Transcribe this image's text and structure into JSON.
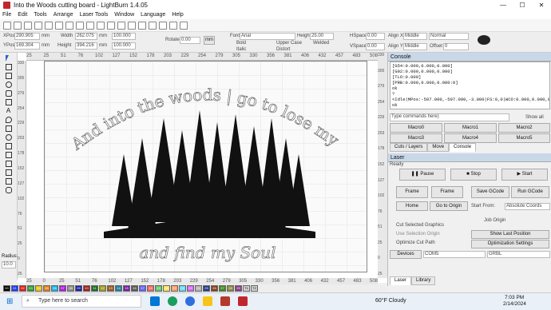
{
  "window": {
    "title": "Into the Woods cutting board - LightBurn 1.4.05"
  },
  "menu": [
    "File",
    "Edit",
    "Tools",
    "Arrange",
    "Laser Tools",
    "Window",
    "Language",
    "Help"
  ],
  "props": {
    "xpos_label": "XPos",
    "xpos": "290.905",
    "ypos_label": "YPos",
    "ypos": "169.304",
    "unit": "mm",
    "width_label": "Width",
    "width": "262.075",
    "height_label": "Height",
    "height": "394.216",
    "pct_w": "100.000",
    "pct_h": "100.000",
    "rotate_label": "Rotate",
    "rotate": "0.00",
    "font_label": "Font",
    "font": "Arial",
    "fheight_label": "Height",
    "fheight": "25.00",
    "bold": "Bold",
    "italic": "Italic",
    "upper": "Upper Case",
    "welded": "Welded",
    "distort": "Distort",
    "hspace_label": "HSpace",
    "hspace": "0.00",
    "vspace_label": "VSpace",
    "vspace": "0.00",
    "alignx_label": "Align X",
    "alignx": "Middle",
    "aligny_label": "Align Y",
    "aligny": "Middle",
    "normal": "Normal",
    "offset_label": "Offset",
    "offset": "0"
  },
  "ruler_top": [
    "25",
    "25",
    "51",
    "76",
    "102",
    "127",
    "152",
    "178",
    "203",
    "229",
    "254",
    "279",
    "305",
    "330",
    "356",
    "381",
    "406",
    "432",
    "457",
    "483",
    "508"
  ],
  "ruler_left": [
    "330",
    "305",
    "279",
    "254",
    "229",
    "203",
    "178",
    "152",
    "127",
    "102",
    "76",
    "51",
    "25",
    "0",
    "25"
  ],
  "ruler_bottom": [
    "25",
    "0",
    "25",
    "51",
    "76",
    "102",
    "127",
    "152",
    "178",
    "203",
    "229",
    "254",
    "279",
    "305",
    "330",
    "356",
    "381",
    "406",
    "432",
    "457",
    "483",
    "508"
  ],
  "design": {
    "arc_text": "And into the woods | go to lose my mind",
    "bottom_text": "and find my Soul"
  },
  "console": {
    "title": "Console",
    "lines": [
      "[G54:0.000,0.000,0.000]",
      "[G92:0.000,0.000,0.000]",
      "[TLO:0.000]",
      "[PRB:0.000,0.000,0.000:0]",
      "ok",
      "?",
      "<Idle|MPos:-597.000,-597.000,-3.000|FS:0,0|WCO:0.000,0.000,0.000>",
      "ok"
    ],
    "placeholder": "Type commands here)",
    "show_all": "Show all",
    "macros": [
      "Macro0",
      "Macro1",
      "Macro2",
      "Macro3",
      "Macro4",
      "Macro5"
    ],
    "tabs": [
      "Cuts / Layers",
      "Move",
      "Console"
    ]
  },
  "laser": {
    "title": "Laser",
    "status": "Ready",
    "pause": "Pause",
    "stop": "Stop",
    "start": "Start",
    "frame1": "Frame",
    "frame2": "Frame",
    "save_gcode": "Save GCode",
    "run_gcode": "Run GCode",
    "home": "Home",
    "goto_origin": "Go to Origin",
    "start_from_label": "Start From:",
    "start_from": "Absolute Coords",
    "job_origin": "Job Origin",
    "cut_selected": "Cut Selected Graphics",
    "use_origin": "Use Selection Origin",
    "optimize": "Optimize Cut Path",
    "show_last": "Show Last Position",
    "opt_settings": "Optimization Settings",
    "devices": "Devices",
    "port": "COM5",
    "controller": "GRBL",
    "tabs": [
      "Laser",
      "Library"
    ]
  },
  "left_tools": {
    "radius_label": "Radius:",
    "radius": "10.0"
  },
  "palette": [
    "00",
    "01",
    "02",
    "03",
    "04",
    "05",
    "06",
    "07",
    "08",
    "09",
    "10",
    "11",
    "12",
    "13",
    "14",
    "15",
    "16",
    "17",
    "18",
    "19",
    "20",
    "21",
    "22",
    "23",
    "24",
    "25",
    "26",
    "27",
    "28",
    "29",
    "T1",
    "T2"
  ],
  "palette_colors": [
    "#000000",
    "#1e3cff",
    "#e21a1a",
    "#2aa02a",
    "#e6c419",
    "#e67e19",
    "#19b4e6",
    "#b419e6",
    "#8c8c8c",
    "#1e1ea0",
    "#a01e1e",
    "#1e6e1e",
    "#a0a01e",
    "#a05a1e",
    "#1e80a0",
    "#7a1ea0",
    "#5a5a5a",
    "#6464ff",
    "#ff6464",
    "#64c864",
    "#ffe164",
    "#ffa064",
    "#64dcff",
    "#dc64ff",
    "#b4b4b4",
    "#1e3c8c",
    "#8c3c1e",
    "#3c8c1e",
    "#8c8c3c",
    "#8c3c8c",
    "#d0d0d0",
    "#d0d0d0"
  ],
  "taskbar": {
    "search": "Type here to search",
    "weather": "60°F  Cloudy",
    "time": "7:03 PM",
    "date": "2/14/2024"
  }
}
